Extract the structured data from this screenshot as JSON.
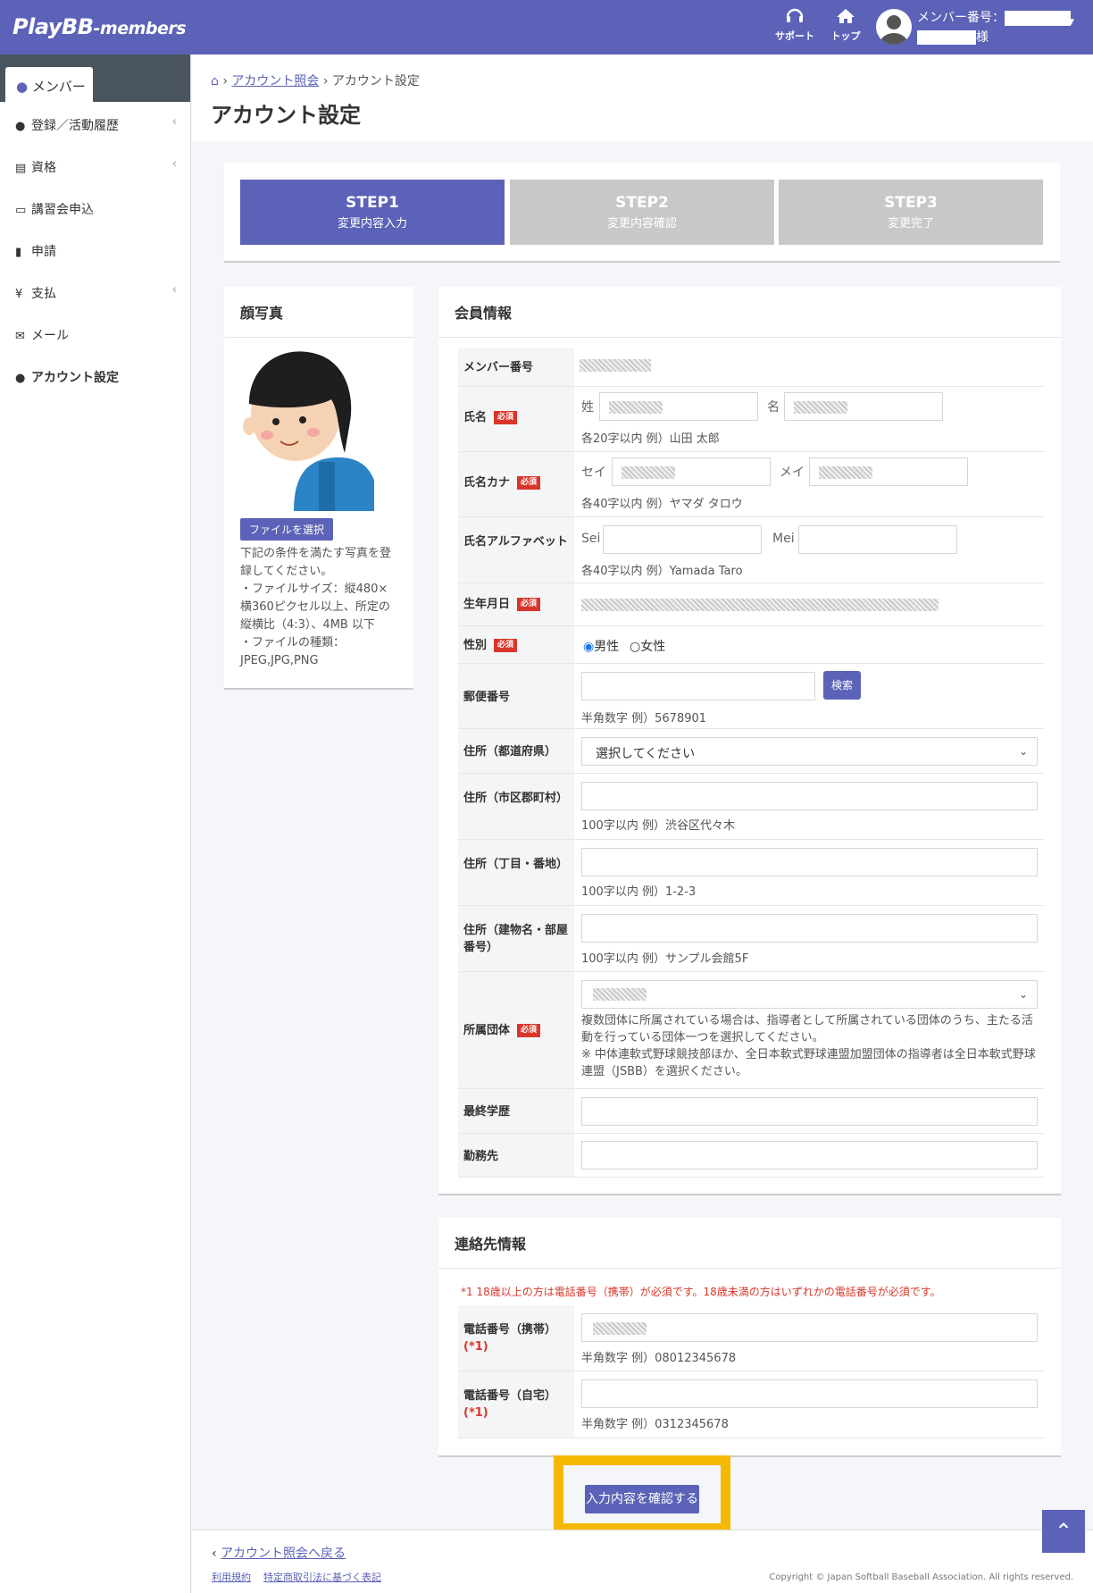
{
  "header": {
    "logo_main": "PlayBB",
    "logo_sub": "-members",
    "nav_support": "サポート",
    "nav_top": "トップ",
    "member_label": "メンバー番号：",
    "member_suffix": "様"
  },
  "sidebar": {
    "tab": "メンバー",
    "items": [
      {
        "label": "登録／活動履歴"
      },
      {
        "label": "資格"
      },
      {
        "label": "講習会申込"
      },
      {
        "label": "申請"
      },
      {
        "label": "支払"
      },
      {
        "label": "メール"
      },
      {
        "label": "アカウント設定"
      }
    ]
  },
  "breadcrumb": {
    "link": "アカウント照会",
    "current": "アカウント設定"
  },
  "page_title": "アカウント設定",
  "steps": [
    {
      "title": "STEP1",
      "sub": "変更内容入力"
    },
    {
      "title": "STEP2",
      "sub": "変更内容確認"
    },
    {
      "title": "STEP3",
      "sub": "変更完了"
    }
  ],
  "photo_card": {
    "title": "顔写真",
    "file_button": "ファイルを選択",
    "note": "下記の条件を満たす写真を登録してください。\n・ファイルサイズ：縦480×横360ピクセル以上、所定の縦横比（4:3）、4MB 以下\n・ファイルの種類：JPEG,JPG,PNG"
  },
  "member_card": {
    "title": "会員情報",
    "required": "必須",
    "member_no": "メンバー番号",
    "name": {
      "label": "氏名",
      "sei": "姓",
      "mei": "名",
      "help": "各20字以内 例）山田 太郎"
    },
    "kana": {
      "label": "氏名カナ",
      "sei": "セイ",
      "mei": "メイ",
      "help": "各40字以内 例）ヤマダ タロウ"
    },
    "alpha": {
      "label": "氏名アルファベット",
      "sei": "Sei",
      "mei": "Mei",
      "help": "各40字以内 例）Yamada Taro"
    },
    "birth": {
      "label": "生年月日"
    },
    "gender": {
      "label": "性別",
      "male": "男性",
      "female": "女性",
      "selected": "男性"
    },
    "zip": {
      "label": "郵便番号",
      "button": "検索",
      "help": "半角数字 例）5678901"
    },
    "pref": {
      "label": "住所（都道府県）",
      "value": "選択してください"
    },
    "city": {
      "label": "住所（市区郡町村）",
      "help": "100字以内 例）渋谷区代々木"
    },
    "block": {
      "label": "住所（丁目・番地）",
      "help": "100字以内 例）1-2-3"
    },
    "bldg": {
      "label": "住所（建物名・部屋番号）",
      "help": "100字以内 例）サンプル会館5F"
    },
    "org": {
      "label": "所属団体",
      "help": "複数団体に所属されている場合は、指導者として所属されている団体のうち、主たる活動を行っている団体一つを選択してください。\n※ 中体連軟式野球競技部ほか、全日本軟式野球連盟加盟団体の指導者は全日本軟式野球連盟（JSBB）を選択ください。"
    },
    "edu": {
      "label": "最終学歴"
    },
    "work": {
      "label": "勤務先"
    }
  },
  "contact_card": {
    "title": "連絡先情報",
    "note": "*1 18歳以上の方は電話番号（携帯）が必須です。18歳未満の方はいずれかの電話番号が必須です。",
    "mobile": {
      "label": "電話番号（携帯）",
      "mark": "(*1)",
      "help": "半角数字 例）08012345678"
    },
    "home": {
      "label": "電話番号（自宅）",
      "mark": "(*1)",
      "help": "半角数字 例）0312345678"
    }
  },
  "confirm_button": "入力内容を確認する",
  "footer": {
    "back": "アカウント照会へ戻る",
    "terms": "利用規約",
    "law": "特定商取引法に基づく表記",
    "copyright": "Copyright © Japan Softball Baseball Association. All rights reserved."
  },
  "colors": {
    "primary": "#5b62b7",
    "required": "#d9362b",
    "highlight": "#f5b800",
    "step_inactive": "#c8c8c8"
  }
}
